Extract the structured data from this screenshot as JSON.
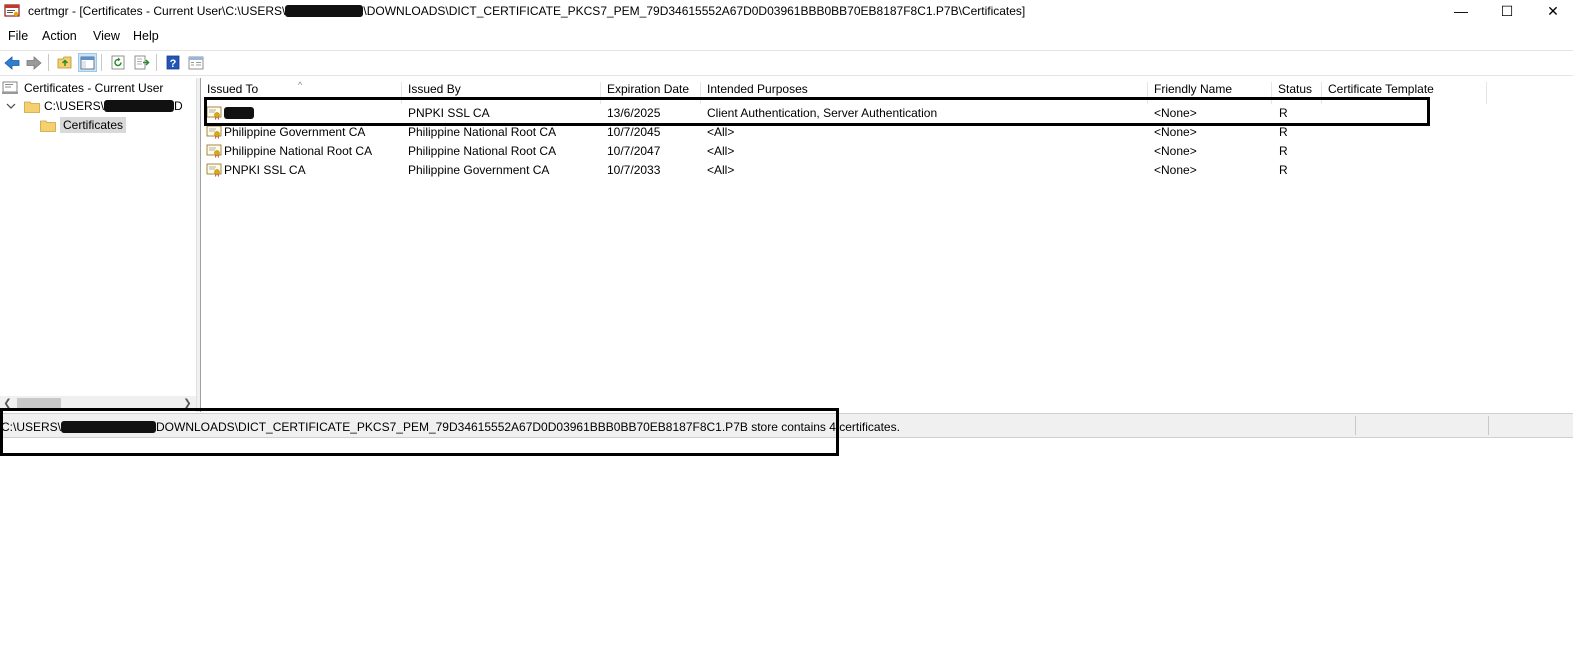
{
  "window": {
    "title": "certmgr - [Certificates - Current User\\C:\\USERS\\",
    "title_tail": "\\DOWNLOADS\\DICT_CERTIFICATE_PKCS7_PEM_79D34615552A67D0D03961BBB0BB70EB8187F8C1.P7B\\Certificates]",
    "minimize_glyph": "—",
    "maximize_glyph": "☐",
    "close_glyph": "✕"
  },
  "menu": {
    "items": [
      "File",
      "Action",
      "View",
      "Help"
    ]
  },
  "toolbar": {
    "buttons": [
      "back-icon",
      "forward-icon",
      "up-folder-icon",
      "show-hide-tree-icon",
      "refresh-icon",
      "export-list-icon",
      "help-icon",
      "properties-icon"
    ]
  },
  "tree": {
    "root_label": "Certificates - Current User",
    "store_label": "C:\\USERS\\",
    "store_tail": "D",
    "certificates_label": "Certificates"
  },
  "list": {
    "columns": [
      "Issued To",
      "Issued By",
      "Expiration Date",
      "Intended Purposes",
      "Friendly Name",
      "Status",
      "Certificate Template"
    ],
    "sort_glyph": "^",
    "rows": [
      {
        "issued_to": "",
        "issued_by": "PNPKI SSL CA",
        "expiration": "13/6/2025",
        "purposes": "Client Authentication, Server Authentication",
        "friendly": "<None>",
        "status": "R",
        "template": ""
      },
      {
        "issued_to": "Philippine Government CA",
        "issued_by": "Philippine National Root CA",
        "expiration": "10/7/2045",
        "purposes": "<All>",
        "friendly": "<None>",
        "status": "R",
        "template": ""
      },
      {
        "issued_to": "Philippine National Root CA",
        "issued_by": "Philippine National Root CA",
        "expiration": "10/7/2047",
        "purposes": "<All>",
        "friendly": "<None>",
        "status": "R",
        "template": ""
      },
      {
        "issued_to": "PNPKI SSL CA",
        "issued_by": "Philippine Government CA",
        "expiration": "10/7/2033",
        "purposes": "<All>",
        "friendly": "<None>",
        "status": "R",
        "template": ""
      }
    ]
  },
  "status": {
    "prefix": "C:\\USERS\\",
    "suffix": "DOWNLOADS\\DICT_CERTIFICATE_PKCS7_PEM_79D34615552A67D0D03961BBB0BB70EB8187F8C1.P7B store contains 4 certificates."
  },
  "colors": {
    "selection": "#d9d9d9",
    "folder": "#f5d06e",
    "highlight_border": "#000000",
    "toolbar_active": "#cce4f7"
  }
}
